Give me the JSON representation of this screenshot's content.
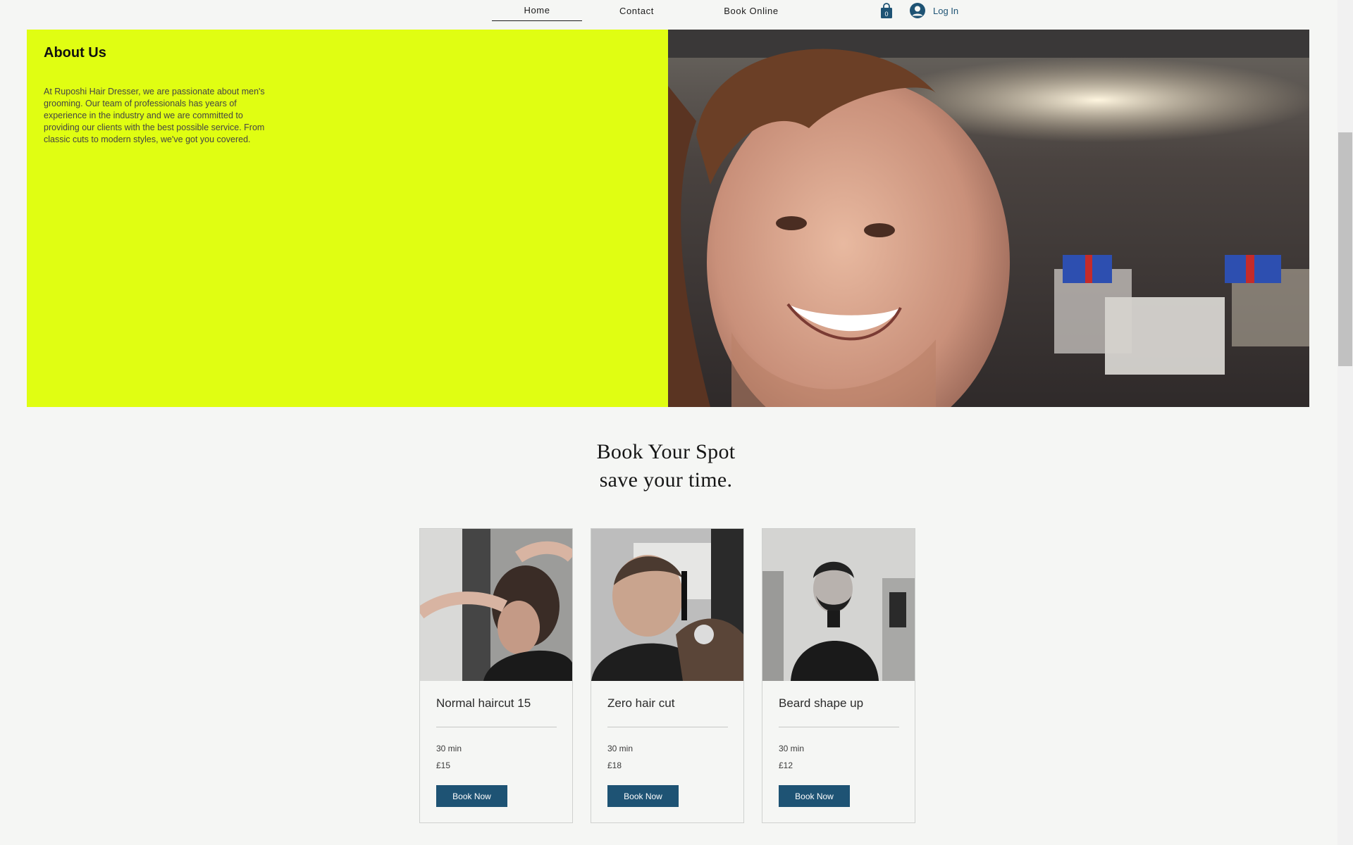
{
  "nav": {
    "items": [
      {
        "label": "Home",
        "active": true
      },
      {
        "label": "Contact",
        "active": false
      },
      {
        "label": "Book Online",
        "active": false
      }
    ],
    "cart_count": "0",
    "login_label": "Log In"
  },
  "about": {
    "title": "About Us",
    "text": "At Ruposhi Hair Dresser, we are passionate about men's grooming. Our team of professionals has years of experience in the industry and we are committed to providing our clients with the best possible service. From classic cuts to modern styles, we've got you covered."
  },
  "booking": {
    "heading_line1": "Book Your Spot",
    "heading_line2": "save your time.",
    "services": [
      {
        "title": "Normal haircut 15",
        "duration": "30 min",
        "price": "£15",
        "button": "Book Now"
      },
      {
        "title": "Zero hair cut",
        "duration": "30 min",
        "price": "£18",
        "button": "Book Now"
      },
      {
        "title": "Beard shape up",
        "duration": "30 min",
        "price": "£12",
        "button": "Book Now"
      }
    ]
  },
  "colors": {
    "accent_panel": "#e0fe12",
    "button": "#1e5374",
    "background": "#f5f6f4"
  }
}
